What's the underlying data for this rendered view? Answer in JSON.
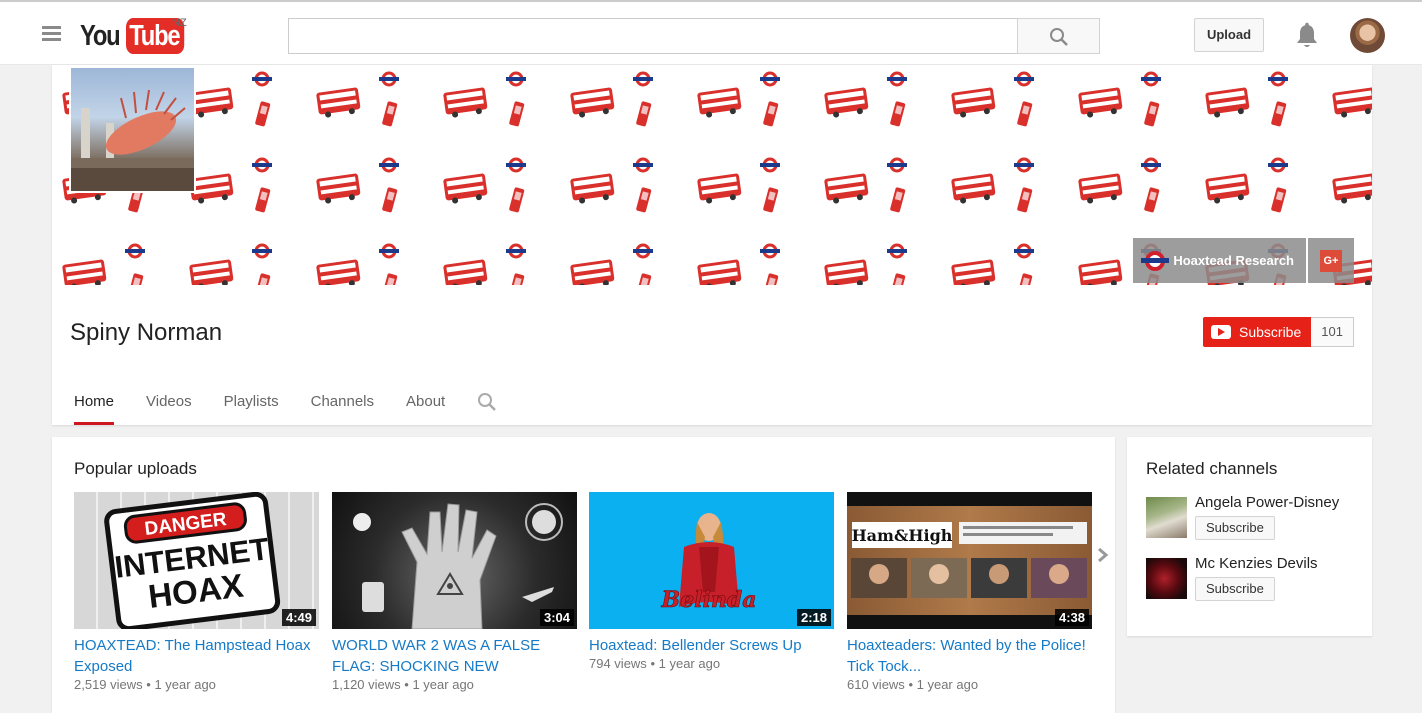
{
  "header": {
    "logo_you": "You",
    "logo_tube": "Tube",
    "region": "NZ",
    "search_placeholder": "",
    "upload_label": "Upload"
  },
  "channel": {
    "name": "Spiny Norman",
    "banner_links": [
      {
        "label": "Hoaxtead Research",
        "icon": "roundel-icon"
      },
      {
        "label": "G+",
        "icon": "google-plus-icon"
      }
    ],
    "subscribe_label": "Subscribe",
    "subscriber_count": "101",
    "tabs": [
      "Home",
      "Videos",
      "Playlists",
      "Channels",
      "About"
    ],
    "active_tab": "Home"
  },
  "popular": {
    "title": "Popular uploads",
    "videos": [
      {
        "title": "HOAXTEAD: The Hampstead Hoax Exposed",
        "duration": "4:49",
        "views": "2,519 views",
        "age": "1 year ago",
        "thumb_text": [
          "DANGER",
          "INTERNET",
          "HOAX"
        ]
      },
      {
        "title": "WORLD WAR 2 WAS A FALSE FLAG: SHOCKING NEW",
        "duration": "3:04",
        "views": "1,120 views",
        "age": "1 year ago"
      },
      {
        "title": "Hoaxtead: Bellender Screws Up",
        "duration": "2:18",
        "views": "794 views",
        "age": "1 year ago",
        "thumb_text": [
          "Belinda"
        ]
      },
      {
        "title": "Hoaxteaders: Wanted by the Police! Tick Tock...",
        "duration": "4:38",
        "views": "610 views",
        "age": "1 year ago",
        "thumb_text": [
          "Ham&High"
        ]
      }
    ],
    "separator": "•"
  },
  "related": {
    "title": "Related channels",
    "channels": [
      {
        "name": "Angela Power-Disney",
        "subscribe_label": "Subscribe"
      },
      {
        "name": "Mc Kenzies Devils",
        "subscribe_label": "Subscribe"
      }
    ]
  },
  "colors": {
    "brand_red": "#e52d27",
    "subscribe_red": "#e62117",
    "link_blue": "#167ac6",
    "tab_underline": "#cc181e"
  }
}
